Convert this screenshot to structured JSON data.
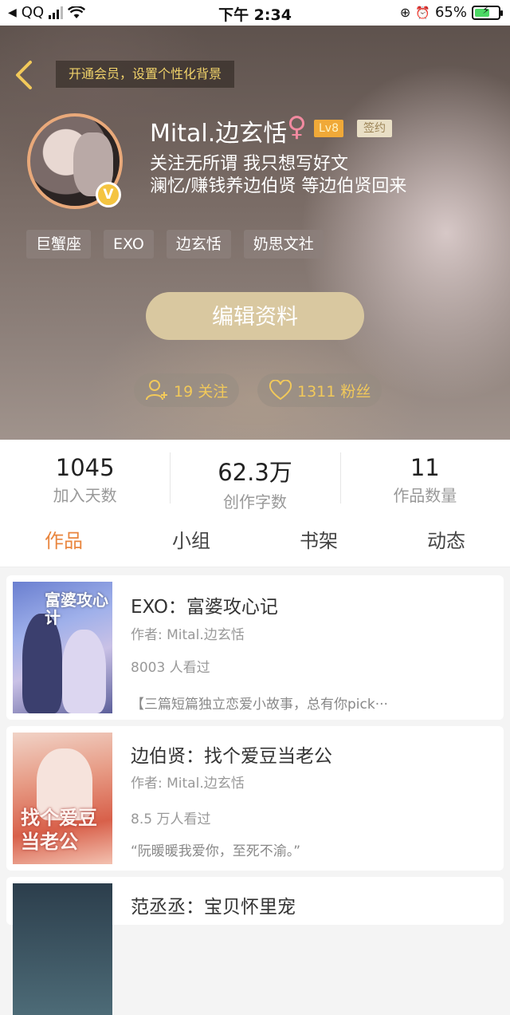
{
  "status_bar": {
    "back_app": "QQ",
    "time": "下午 2:34",
    "battery": "65%",
    "battery_level": 0.65
  },
  "header": {
    "vip_banner": "开通会员，设置个性化背景",
    "username": "Mital.边玄恬",
    "gender_symbol": "♀",
    "level": "Lv8",
    "sign_badge": "签约",
    "verified_badge": "V",
    "bio_line1": "关注无所谓 我只想写好文",
    "bio_line2": "澜忆/赚钱养边伯贤 等边伯贤回来",
    "tags": [
      "巨蟹座",
      "EXO",
      "边玄恬",
      "奶思文社"
    ],
    "edit_button": "编辑资料",
    "following": "19 关注",
    "fans": "1311 粉丝"
  },
  "stats": [
    {
      "value": "1045",
      "label": "加入天数"
    },
    {
      "value": "62.3万",
      "label": "创作字数"
    },
    {
      "value": "11",
      "label": "作品数量"
    }
  ],
  "tabs": [
    "作品",
    "小组",
    "书架",
    "动态"
  ],
  "works": [
    {
      "title": "EXO：富婆攻心记",
      "author": "作者: Mital.边玄恬",
      "views": "8003 人看过",
      "desc": "【三篇短篇独立恋爱小故事，总有你pick···",
      "cover_text": "富婆攻心计"
    },
    {
      "title": "边伯贤：找个爱豆当老公",
      "author": "作者: Mital.边玄恬",
      "views": "8.5 万人看过",
      "desc": "“阮暖暖我爱你，至死不渝。”",
      "cover_text": "找个爱豆当老公"
    },
    {
      "title": "范丞丞：宝贝怀里宠"
    }
  ],
  "colors": {
    "accent": "#e9863f",
    "gold": "#f2c95a",
    "edit_button": "#d9c8a0"
  }
}
